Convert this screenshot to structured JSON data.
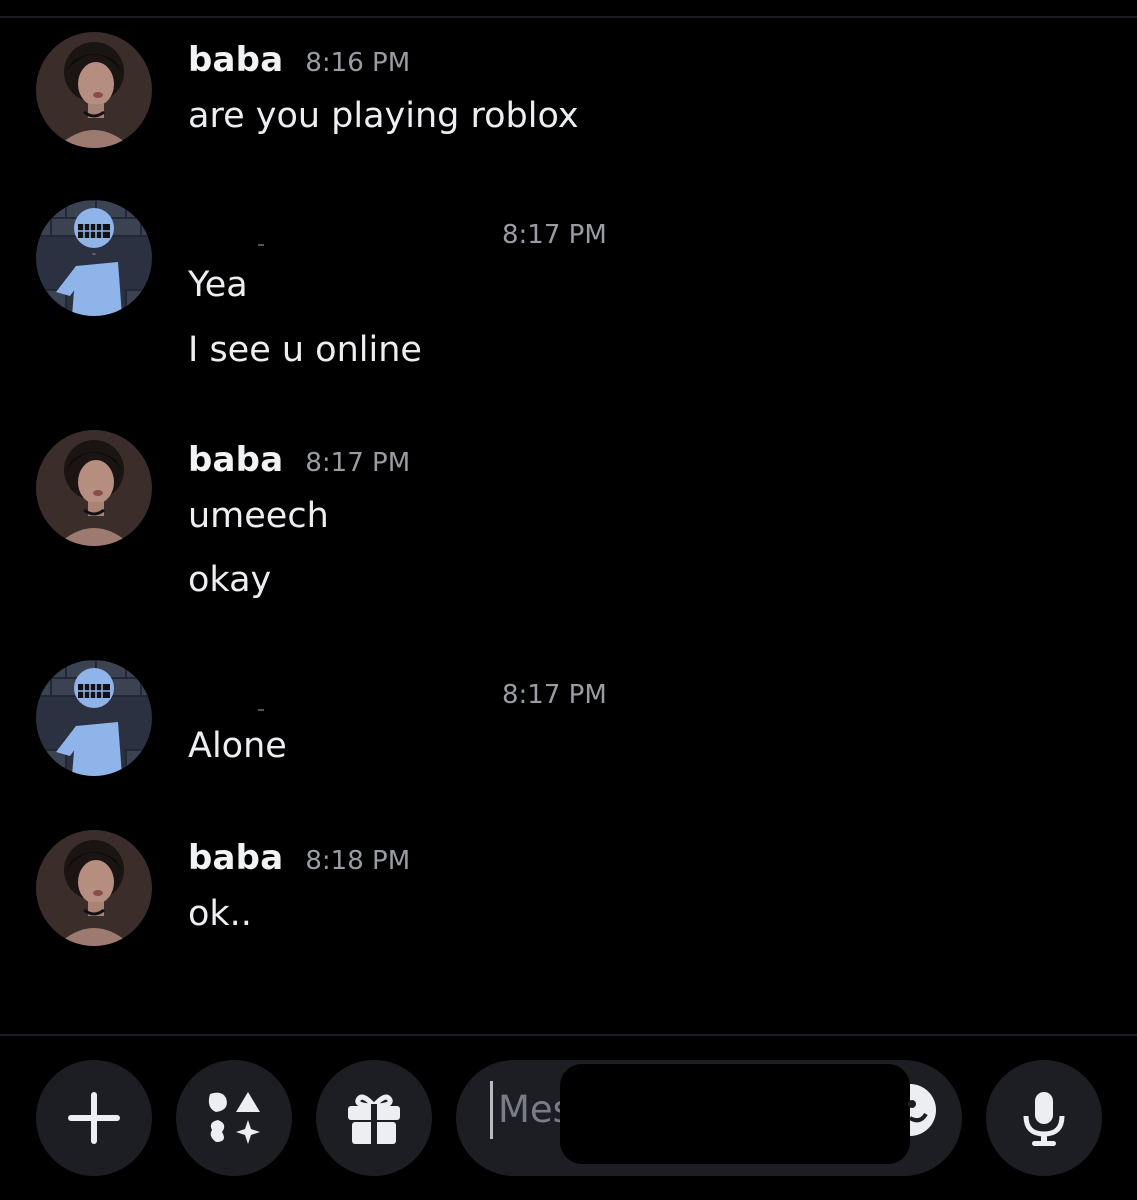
{
  "messages": [
    {
      "author": "baba",
      "time": "8:16 PM",
      "lines": [
        "are you playing roblox"
      ],
      "avatar": "photo-avatar-icon"
    },
    {
      "author": "",
      "time": "8:17 PM",
      "lines": [
        "Yea",
        "I see u online"
      ],
      "avatar": "cartoon-avatar-icon"
    },
    {
      "author": "baba",
      "time": "8:17 PM",
      "lines": [
        "umeech",
        "okay"
      ],
      "avatar": "photo-avatar-icon"
    },
    {
      "author": "",
      "time": "8:17 PM",
      "lines": [
        "Alone"
      ],
      "avatar": "cartoon-avatar-icon"
    },
    {
      "author": "baba",
      "time": "8:18 PM",
      "lines": [
        "ok.."
      ],
      "avatar": "photo-avatar-icon"
    }
  ],
  "composer": {
    "placeholder": "Mes",
    "icons": [
      "plus-icon",
      "apps-icon",
      "gift-icon",
      "emoji-icon",
      "microphone-icon"
    ]
  },
  "colors": {
    "background": "#000000",
    "surface": "#1d1e24",
    "timestamp": "#9a9ca4",
    "avatar_cartoon_blue": "#8fb4ea"
  }
}
